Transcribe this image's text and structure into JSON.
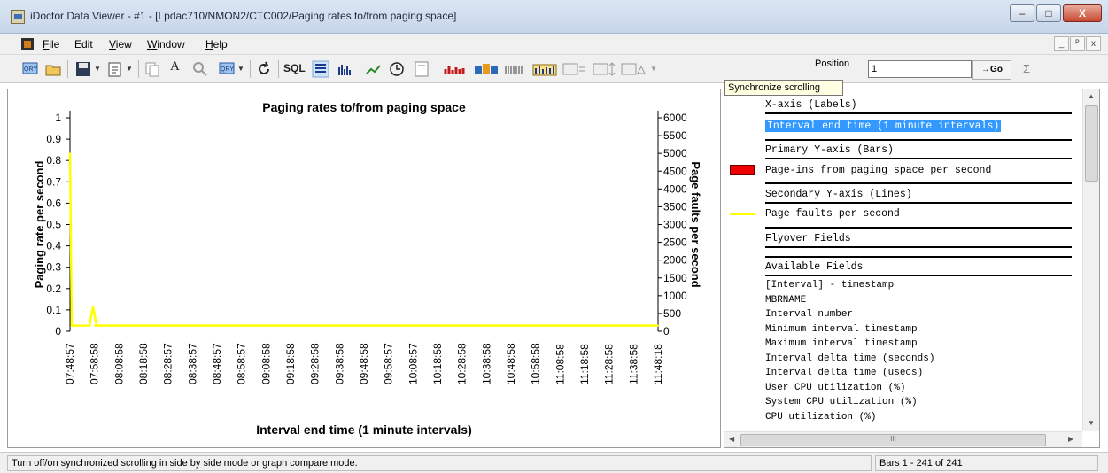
{
  "window": {
    "title": "iDoctor Data Viewer - #1 - [Lpdac710/NMON2/CTC002/Paging rates to/from paging space]",
    "minimize": "–",
    "maximize": "□",
    "close": "X"
  },
  "menu": {
    "items": [
      {
        "name": "File",
        "underline": "F",
        "rest": "ile"
      },
      {
        "name": "Edit",
        "underline": "",
        "rest": "Edit"
      },
      {
        "name": "View",
        "underline": "V",
        "rest": "iew"
      },
      {
        "name": "Window",
        "underline": "W",
        "rest": "indow"
      },
      {
        "name": "Help",
        "underline": "H",
        "rest": "elp"
      }
    ],
    "mdi_min": "_",
    "mdi_restore": "ᴾ",
    "mdi_close": "x"
  },
  "toolbar": {
    "sql_label": "SQL",
    "font_label": "A",
    "position_label": "Position",
    "position_value": "1",
    "go_label": "→Go",
    "sum_label": "Σ",
    "tooltip": "Synchronize scrolling"
  },
  "chart_data": {
    "type": "bar",
    "title": "Paging rates to/from paging space",
    "xlabel": "Interval end time (1 minute intervals)",
    "ylabel": "Paging rate per second",
    "y2label": "Page faults per second",
    "ylim": [
      0,
      1
    ],
    "y2lim": [
      0,
      6000
    ],
    "yticks": [
      "1",
      "0.9",
      "0.8",
      "0.7",
      "0.6",
      "0.5",
      "0.4",
      "0.3",
      "0.2",
      "0.1",
      "0"
    ],
    "y2ticks": [
      "6000",
      "5500",
      "5000",
      "4500",
      "4000",
      "3500",
      "3000",
      "2500",
      "2000",
      "1500",
      "1000",
      "500",
      "0"
    ],
    "categories": [
      "07:48:57",
      "07:58:58",
      "08:08:58",
      "08:18:58",
      "08:28:57",
      "08:38:57",
      "08:48:57",
      "08:58:57",
      "09:08:58",
      "09:18:58",
      "09:28:58",
      "09:38:58",
      "09:48:58",
      "09:58:57",
      "10:08:57",
      "10:18:58",
      "10:28:58",
      "10:38:58",
      "10:48:58",
      "10:58:58",
      "11:08:58",
      "11:18:58",
      "11:28:58",
      "11:38:58",
      "11:48:18"
    ],
    "series": [
      {
        "name": "Page-ins from paging space per second",
        "axis": "primary",
        "color": "#ee0000",
        "values": [
          0,
          0,
          0,
          0,
          0,
          0,
          0,
          0,
          0,
          0,
          0,
          0,
          0,
          0,
          0,
          0,
          0,
          0,
          0,
          0,
          0,
          0,
          0,
          0,
          0
        ]
      },
      {
        "name": "Page faults per second",
        "axis": "secondary",
        "color": "#ffff00",
        "values": [
          5000,
          160,
          160,
          160,
          160,
          160,
          160,
          160,
          160,
          160,
          160,
          160,
          160,
          160,
          160,
          160,
          160,
          160,
          160,
          160,
          160,
          160,
          160,
          160,
          160
        ]
      }
    ],
    "grid": false,
    "legend": "none"
  },
  "fields_panel": {
    "xaxis_header": "X-axis (Labels)",
    "xaxis_value": "Interval end time (1 minute intervals)",
    "primary_header": "Primary Y-axis (Bars)",
    "primary_value": "Page-ins from paging space per second",
    "secondary_header": "Secondary Y-axis (Lines)",
    "secondary_value": "Page faults per second",
    "flyover_header": "Flyover Fields",
    "available_header": "Available Fields",
    "available_fields": [
      "[Interval] - timestamp",
      "MBRNAME",
      "Interval number",
      "Minimum interval timestamp",
      "Maximum interval timestamp",
      "Interval delta time (seconds)",
      "Interval delta time (usecs)",
      "User CPU utilization (%)",
      "System CPU utilization (%)",
      "CPU utilization (%)"
    ],
    "hscroll_grip": "III"
  },
  "status": {
    "message": "Turn off/on synchronized scrolling in side by side mode or graph compare mode.",
    "bars": "Bars 1 - 241 of 241"
  }
}
